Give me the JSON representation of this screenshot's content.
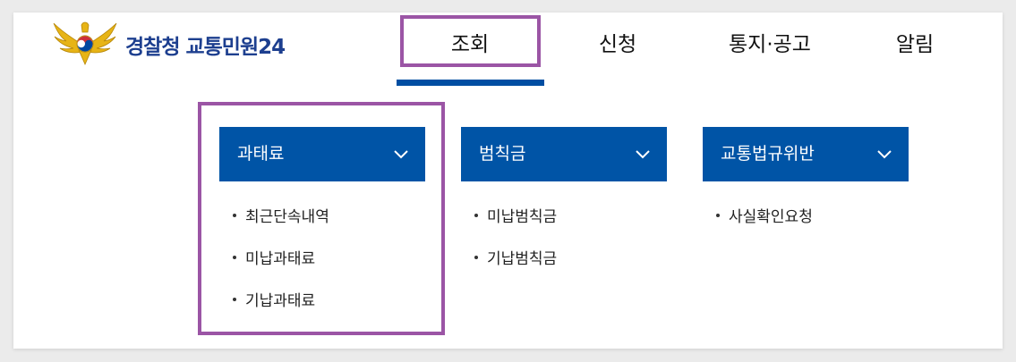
{
  "brand": {
    "title": "경찰청 교통민원24"
  },
  "nav": {
    "items": [
      {
        "label": "조회"
      },
      {
        "label": "신청"
      },
      {
        "label": "통지·공고"
      },
      {
        "label": "알림"
      }
    ]
  },
  "submenu": {
    "panels": [
      {
        "title": "과태료",
        "items": [
          "최근단속내역",
          "미납과태료",
          "기납과태료"
        ]
      },
      {
        "title": "범칙금",
        "items": [
          "미납범칙금",
          "기납범칙금"
        ]
      },
      {
        "title": "교통법규위반",
        "items": [
          "사실확인요청"
        ]
      }
    ]
  },
  "colors": {
    "primary": "#0054a6",
    "brand_text": "#1d3f8f",
    "highlight": "#9b55a5"
  }
}
